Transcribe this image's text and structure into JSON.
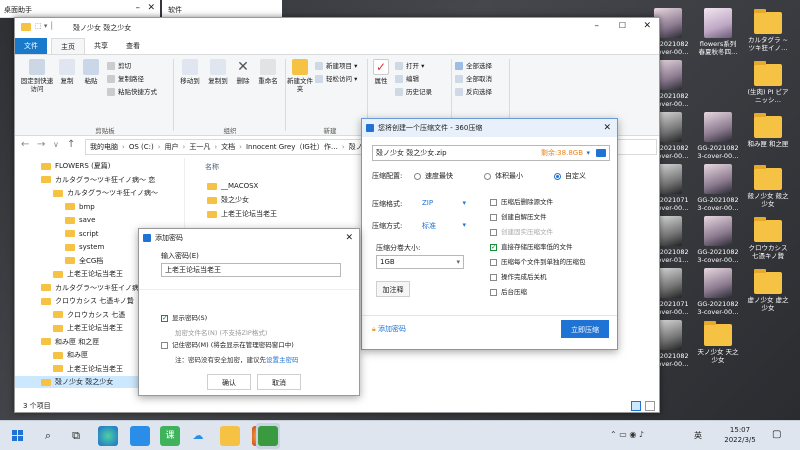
{
  "background_windows": {
    "left_title": "桌面助手",
    "mid_title": "软件"
  },
  "desktop_icons": [
    {
      "label": "GG-2021082 3-cover-00…",
      "kind": "thumb"
    },
    {
      "label": "flowers系列 春夏秋冬四…",
      "kind": "thumb"
    },
    {
      "label": "カルタグラ ~ツキ狂イノ…",
      "kind": "folder"
    },
    {
      "label": "GG-2021082 3-cover-00…",
      "kind": "thumb"
    },
    {
      "label": "(生肉) PI ビアニッシ…",
      "kind": "folder"
    },
    {
      "label": "GG-2021082 3-cover-00…",
      "kind": "thumb"
    },
    {
      "label": "GG-2021082 3-cover-00…",
      "kind": "thumb"
    },
    {
      "label": "和み匣 和之匣",
      "kind": "folder"
    },
    {
      "label": "GG-2021071 0-cover-00…",
      "kind": "thumb"
    },
    {
      "label": "GG-2021082 3-cover-00…",
      "kind": "thumb"
    },
    {
      "label": "殻ノ少女 殻之少女",
      "kind": "folder"
    },
    {
      "label": "GG-2021082 3-cover-01…",
      "kind": "thumb"
    },
    {
      "label": "GG-2021082 3-cover-00…",
      "kind": "thumb"
    },
    {
      "label": "クロウカシス 七憑キノ贄",
      "kind": "folder"
    },
    {
      "label": "GG-2021071 0-cover-00…",
      "kind": "thumb"
    },
    {
      "label": "GG-2021082 3-cover-00…",
      "kind": "thumb"
    },
    {
      "label": "虚ノ少女 虚之少女",
      "kind": "folder"
    },
    {
      "label": "GG-2021082 3-cover-00…",
      "kind": "thumb"
    },
    {
      "label": "天ノ少女 天之少女",
      "kind": "folder"
    }
  ],
  "explorer": {
    "title": "殻ノ少女 殻之少女",
    "tabs": [
      "文件",
      "主页",
      "共享",
      "查看"
    ],
    "ribbon": {
      "pin_label": "固定到快速访问",
      "copy_label": "复制",
      "paste_label": "粘贴",
      "cut_label": "剪切",
      "copy_path_label": "复制路径",
      "paste_shortcut_label": "粘贴快捷方式",
      "clipboard_group": "剪贴板",
      "move_to_label": "移动到",
      "copy_to_label": "复制到",
      "delete_label": "删除",
      "rename_label": "重命名",
      "organize_group": "组织",
      "new_folder_label": "新建文件夹",
      "new_item_label": "新建项目 ▾",
      "easy_access_label": "轻松访问 ▾",
      "new_group": "新建",
      "properties_label": "属性",
      "open_label": "打开 ▾",
      "edit_label": "编辑",
      "history_label": "历史记录",
      "open_group": "打开",
      "select_all_label": "全部选择",
      "select_none_label": "全部取消",
      "invert_label": "反向选择",
      "select_group": "选择"
    },
    "breadcrumbs": [
      "我的电脑",
      "OS (C:)",
      "用户",
      "王一凡",
      "文档",
      "Innocent Grey（IG社）作…",
      "殻ノ少女 殻…"
    ],
    "nav_items": [
      {
        "label": "FLOWERS (夏篇)",
        "indent": 1
      },
      {
        "label": "カルタグラ～ツキ狂イノ病～ 恋",
        "indent": 1
      },
      {
        "label": "カルタグラ～ツキ狂イノ病～",
        "indent": 2
      },
      {
        "label": "bmp",
        "indent": 3
      },
      {
        "label": "save",
        "indent": 3
      },
      {
        "label": "script",
        "indent": 3
      },
      {
        "label": "system",
        "indent": 3
      },
      {
        "label": "全CG档",
        "indent": 3
      },
      {
        "label": "上老王论坛当老王",
        "indent": 2
      },
      {
        "label": "カルタグラ～ツキ狂イノ病～",
        "indent": 1
      },
      {
        "label": "クロウカシス 七憑キノ贄",
        "indent": 1
      },
      {
        "label": "クロウカシス 七憑",
        "indent": 2
      },
      {
        "label": "上老王论坛当老王",
        "indent": 2
      },
      {
        "label": "和み匣 和之匣",
        "indent": 1
      },
      {
        "label": "和み匣",
        "indent": 2
      },
      {
        "label": "上老王论坛当老王",
        "indent": 2
      },
      {
        "label": "殻ノ少女 殻之少女",
        "indent": 1,
        "selected": true
      }
    ],
    "column_name": "名称",
    "files": [
      "__MACOSX",
      "殻之少女",
      "上老王论坛当老王"
    ],
    "status": "3 个项目"
  },
  "zip_dialog": {
    "title": "您将创建一个压缩文件 - 360压缩",
    "filename": "殻ノ少女 殻之少女.zip",
    "free_space": "剩余:38.8GB",
    "config_label": "压缩配置:",
    "radio_options": [
      "速度最快",
      "体积最小",
      "自定义"
    ],
    "selected_radio": 2,
    "format_label": "压缩格式:",
    "format_value": "ZIP",
    "method_label": "压缩方式:",
    "method_value": "标准",
    "split_label": "压缩分卷大小:",
    "split_value": "1GB",
    "comment_button": "加注释",
    "add_password": "添加密码",
    "checkboxes": [
      {
        "label": "压缩后删除源文件",
        "checked": false
      },
      {
        "label": "创建自解压文件",
        "checked": false
      },
      {
        "label": "创建固实压缩文件",
        "checked": false,
        "disabled": true
      },
      {
        "label": "直接存储压缩率低的文件",
        "checked": true
      },
      {
        "label": "压缩每个文件到单独的压缩包",
        "checked": false
      },
      {
        "label": "操作完成后关机",
        "checked": false
      },
      {
        "label": "后台压缩",
        "checked": false
      }
    ],
    "start_button": "立即压缩"
  },
  "pwd_dialog": {
    "title": "添加密码",
    "input_label": "输入密码(E)",
    "password_value": "上老王论坛当老王",
    "show_pwd_label": "显示密码(S)",
    "show_pwd_checked": true,
    "encrypt_names_label": "加密文件名(N) (不支持ZIP格式)",
    "remember_label": "记住密码(M) (将会显示在管理密码窗口中)",
    "note": "注：密码没有安全加密，建议先",
    "note_link": "设置主密码",
    "ok_button": "确认",
    "cancel_button": "取消"
  },
  "taskbar": {
    "time": "15:07",
    "date": "2022/3/5",
    "lang": "英",
    "apps": [
      "windows-icon",
      "search-icon",
      "task-view-icon",
      "edge-icon",
      "store-icon",
      "green-app-icon",
      "baidu-netdisk-icon",
      "explorer-icon",
      "browser-icon",
      "zip-icon"
    ]
  },
  "colors": {
    "accent": "#1e73d4",
    "orange": "#e8841a",
    "folder": "#f6c244"
  }
}
